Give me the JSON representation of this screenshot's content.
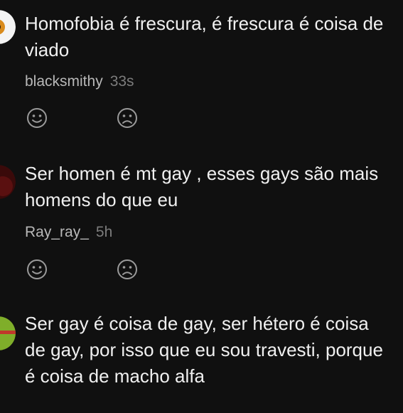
{
  "comments": [
    {
      "text": "Homofobia é frescura, é frescura é coisa de viado",
      "username": "blacksmithy",
      "time": "33s",
      "avatar_colors": {
        "bg": "#f4f4f4",
        "accent": "#d98b1c",
        "dark": "#2a1a0a"
      },
      "reactions": {
        "like": "smile-icon",
        "dislike": "frown-icon"
      }
    },
    {
      "text": "Ser homen é mt gay , esses gays são mais homens do que eu",
      "username": "Ray_ray_",
      "time": "5h",
      "avatar_colors": {
        "bg": "#3a0a0a",
        "accent": "#5a1010"
      },
      "reactions": {
        "like": "smile-icon",
        "dislike": "frown-icon"
      }
    },
    {
      "text": "Ser gay é coisa de gay, ser hétero é coisa de gay, por isso que eu sou travesti, porque é coisa de macho alfa",
      "avatar_colors": {
        "bg": "#7fae2a",
        "accent": "#c0392b",
        "dark": "#d4c24a"
      }
    }
  ],
  "icon_color": "#9a9a9a"
}
